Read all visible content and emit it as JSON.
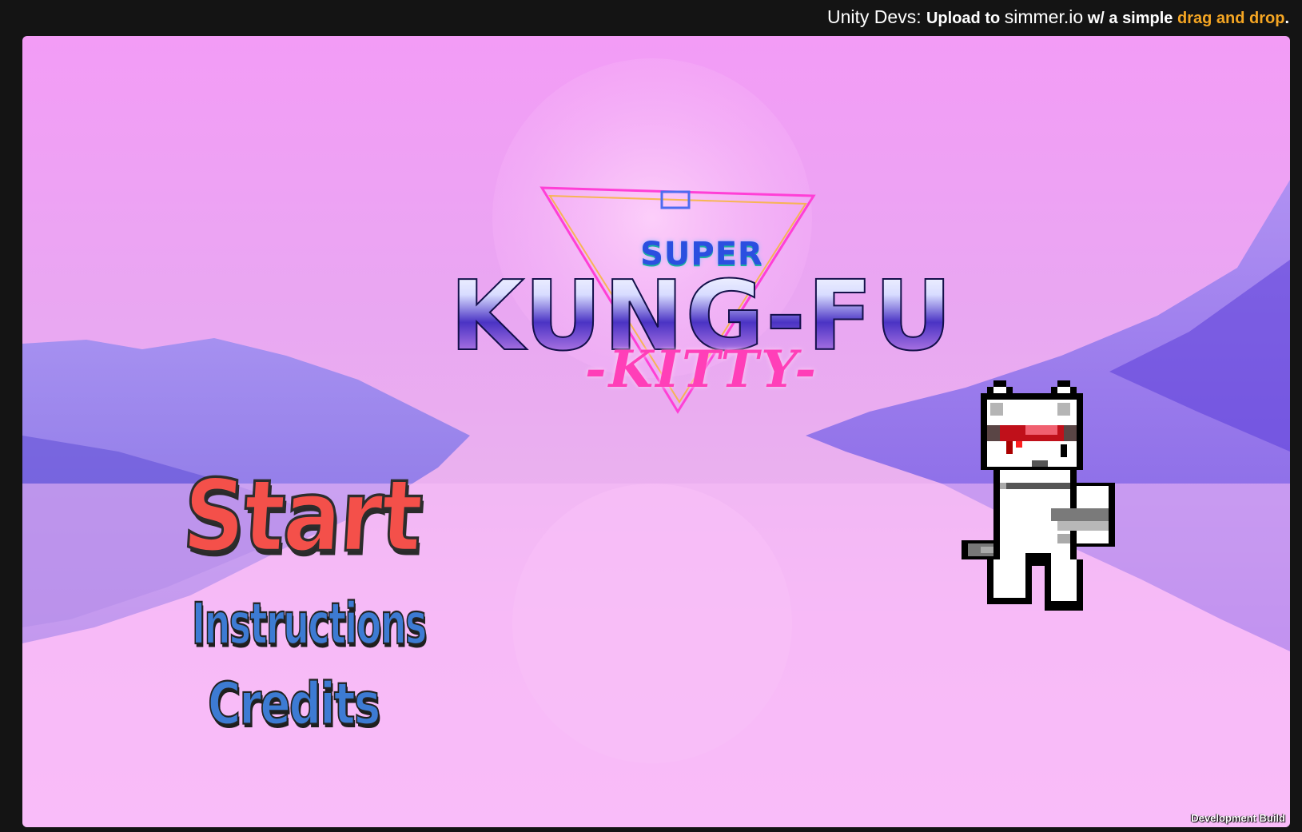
{
  "top_bar": {
    "prefix": "Unity Devs: ",
    "upload_to": "Upload to ",
    "site": "simmer.io",
    "with_simple": " w/ a simple ",
    "drag_and_drop": "drag and drop",
    "period": "."
  },
  "game": {
    "title": {
      "super": "SUPER",
      "main": "KUNG-FU",
      "sub": "-KITTY-"
    },
    "menu": {
      "start": "Start",
      "instructions": "Instructions",
      "credits": "Credits"
    },
    "footer": {
      "dev_build": "Development Build"
    },
    "colors": {
      "start": "#f4504a",
      "secondary": "#3d7bd3",
      "accent": "#f5a623"
    }
  }
}
